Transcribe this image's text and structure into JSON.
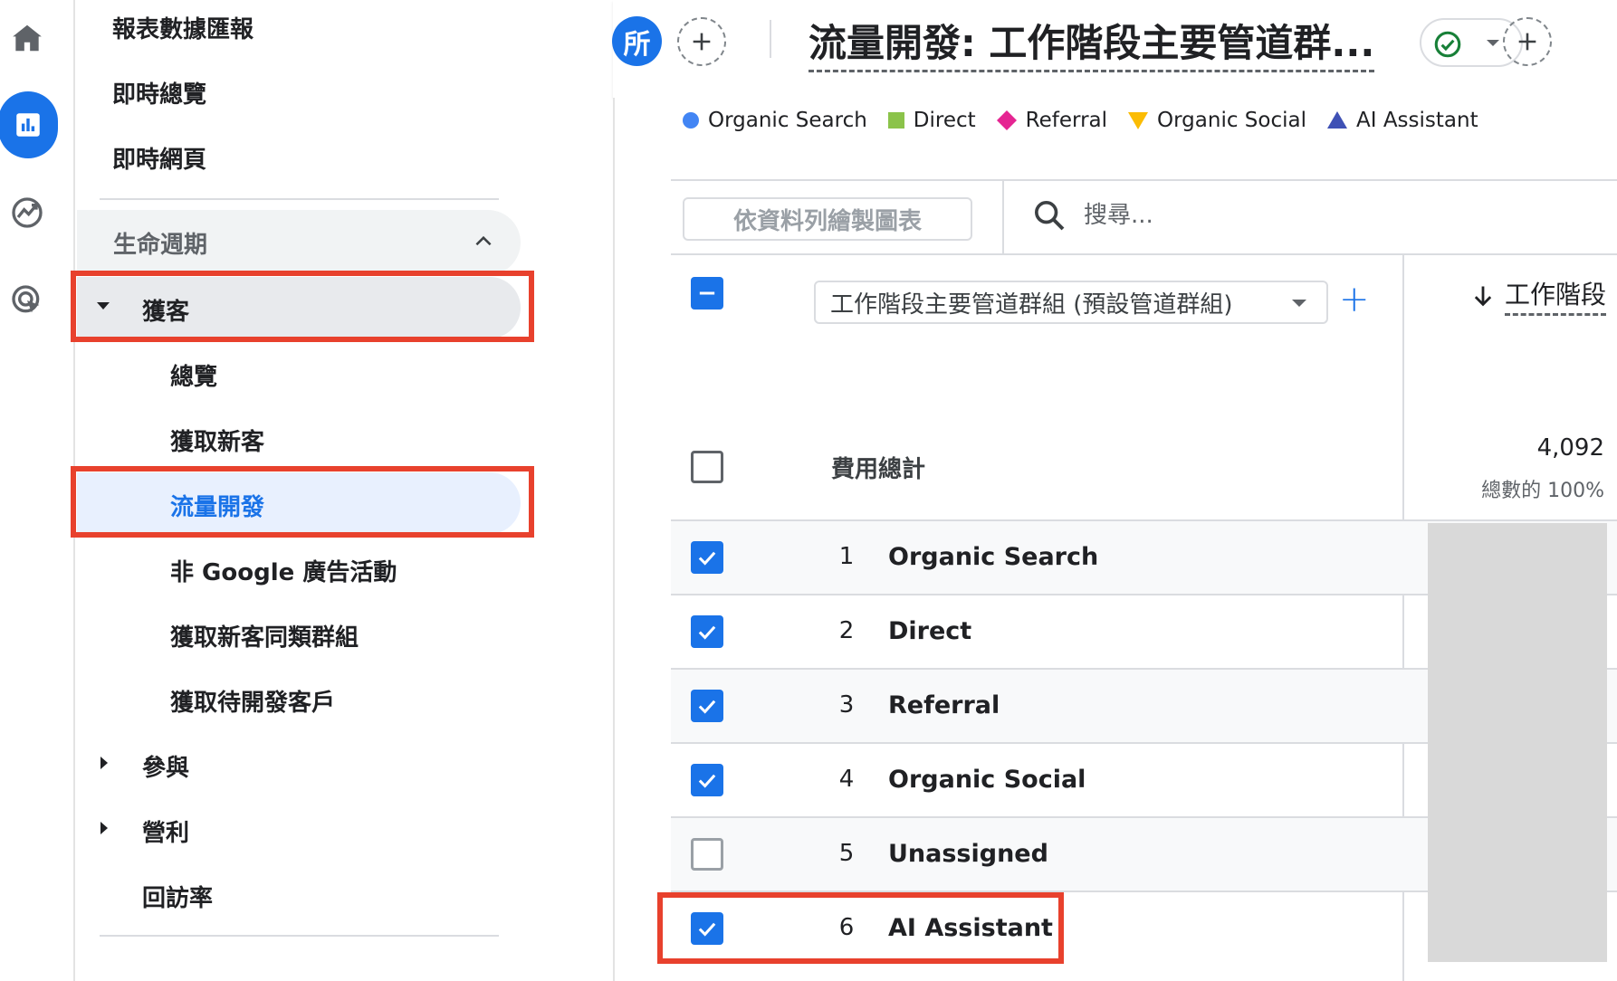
{
  "rail": {
    "icons": [
      "home-icon",
      "reports-icon",
      "explore-icon",
      "advertising-icon"
    ],
    "active": "reports-icon",
    "accent": "#1a73e8"
  },
  "nav": {
    "top_items": [
      "報表數據匯報",
      "即時總覽",
      "即時網頁"
    ],
    "section": {
      "label": "生命週期",
      "expanded": true
    },
    "acquisition": {
      "label": "獲客",
      "children": [
        "總覽",
        "獲取新客",
        "流量開發",
        "非 Google 廣告活動",
        "獲取新客同類群組",
        "獲取待開發客戶"
      ],
      "active_child": "流量開發"
    },
    "collapsed": [
      "參與",
      "營利"
    ],
    "retention": "回訪率"
  },
  "header": {
    "avatar_letter": "所",
    "title": "流量開發: 工作階段主要管道群..."
  },
  "legend": [
    {
      "label": "Organic Search",
      "color": "#4285f4",
      "shape": "circle"
    },
    {
      "label": "Direct",
      "color": "#8bc34a",
      "shape": "square"
    },
    {
      "label": "Referral",
      "color": "#e52592",
      "shape": "diamond"
    },
    {
      "label": "Organic Social",
      "color": "#fbbc04",
      "shape": "triangle-down"
    },
    {
      "label": "AI Assistant",
      "color": "#3f51b5",
      "shape": "triangle-up"
    }
  ],
  "toolbar": {
    "plot_button": "依資料列繪製圖表",
    "search_placeholder": "搜尋..."
  },
  "table": {
    "dimension_label": "工作階段主要管道群組 (預設管道群組)",
    "metric_label": "工作階段",
    "totals": {
      "label": "費用總計",
      "value": "4,092",
      "percent": "總數的 100%"
    },
    "rows": [
      {
        "rank": "1",
        "name": "Organic Search",
        "checked": true
      },
      {
        "rank": "2",
        "name": "Direct",
        "checked": true
      },
      {
        "rank": "3",
        "name": "Referral",
        "checked": true
      },
      {
        "rank": "4",
        "name": "Organic Social",
        "checked": true
      },
      {
        "rank": "5",
        "name": "Unassigned",
        "checked": false
      },
      {
        "rank": "6",
        "name": "AI Assistant",
        "checked": true
      }
    ]
  },
  "highlight_color": "#e8412d"
}
